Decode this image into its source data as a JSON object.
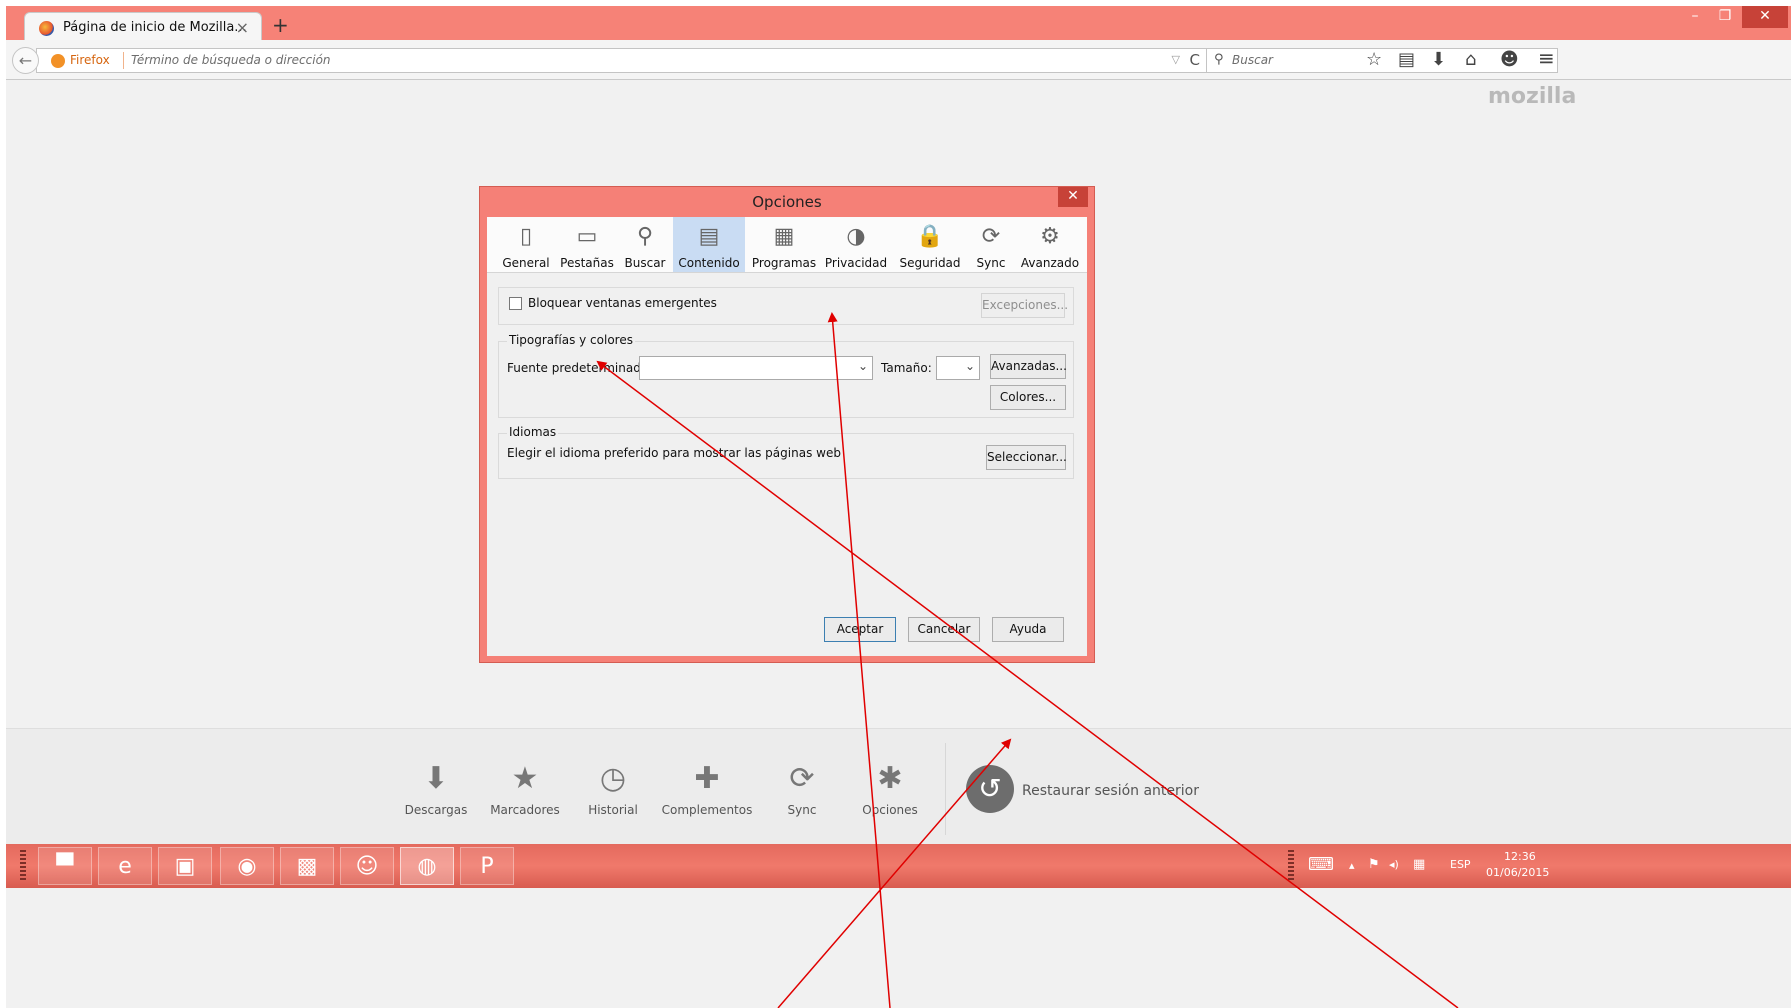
{
  "tab": {
    "title": "Página de inicio de Mozilla...",
    "close": "×",
    "new_tab": "+"
  },
  "window_controls": {
    "minimize": "–",
    "maximize": "❐",
    "close": "✕"
  },
  "navbar": {
    "back_icon": "←",
    "identity_label": "Firefox",
    "url_placeholder": "Término de búsqueda o dirección",
    "dropdown_icon": "▽",
    "reload_icon": "C",
    "search_icon": "⚲",
    "search_placeholder": "Buscar",
    "bookmark_icon": "☆",
    "reading_list_icon": "▤",
    "download_icon": "⬇",
    "home_icon": "⌂",
    "chat_icon": "☻",
    "menu_icon": "≡"
  },
  "page": {
    "logo": "mozilla",
    "launcher": [
      {
        "name": "downloads",
        "icon": "⬇",
        "label": "Descargas"
      },
      {
        "name": "bookmarks",
        "icon": "★",
        "label": "Marcadores"
      },
      {
        "name": "history",
        "icon": "◷",
        "label": "Historial"
      },
      {
        "name": "addons",
        "icon": "✚",
        "label": "Complementos"
      },
      {
        "name": "sync",
        "icon": "⟳",
        "label": "Sync"
      },
      {
        "name": "options",
        "icon": "✱",
        "label": "Opciones"
      }
    ],
    "restore_icon": "↺",
    "restore_label": "Restaurar sesión anterior"
  },
  "dialog": {
    "title": "Opciones",
    "close": "✕",
    "tabs": [
      {
        "name": "general",
        "icon": "▯",
        "label": "General"
      },
      {
        "name": "tabs",
        "icon": "▭",
        "label": "Pestañas"
      },
      {
        "name": "search",
        "icon": "⚲",
        "label": "Buscar"
      },
      {
        "name": "content",
        "icon": "▤",
        "label": "Contenido"
      },
      {
        "name": "applications",
        "icon": "▦",
        "label": "Programas"
      },
      {
        "name": "privacy",
        "icon": "◑",
        "label": "Privacidad"
      },
      {
        "name": "security",
        "icon": "🔒",
        "label": "Seguridad"
      },
      {
        "name": "sync",
        "icon": "⟳",
        "label": "Sync"
      },
      {
        "name": "advanced",
        "icon": "⚙",
        "label": "Avanzado"
      }
    ],
    "selected_tab": "Contenido",
    "popup": {
      "label": "Bloquear ventanas emergentes",
      "checked": false,
      "exceptions": "Excepciones..."
    },
    "fonts": {
      "legend": "Tipografías y colores",
      "default_font_label": "Fuente predeterminada:",
      "default_font_value": "",
      "size_label": "Tamaño:",
      "size_value": "",
      "advanced": "Avanzadas...",
      "colors": "Colores..."
    },
    "languages": {
      "legend": "Idiomas",
      "text": "Elegir el idioma preferido para mostrar las páginas web",
      "choose": "Seleccionar..."
    },
    "buttons": {
      "ok": "Aceptar",
      "cancel": "Cancelar",
      "help": "Ayuda"
    }
  },
  "taskbar": {
    "apps": [
      {
        "name": "explorer",
        "icon": "▀"
      },
      {
        "name": "internet-explorer",
        "icon": "e"
      },
      {
        "name": "media",
        "icon": "▣"
      },
      {
        "name": "chrome",
        "icon": "◉"
      },
      {
        "name": "remote",
        "icon": "▩"
      },
      {
        "name": "people",
        "icon": "☺"
      },
      {
        "name": "firefox",
        "icon": "◍"
      },
      {
        "name": "powerpoint",
        "icon": "P"
      }
    ],
    "tray": {
      "keyboard_icon": "⌨",
      "up_icon": "▴",
      "flag_icon": "⚑",
      "volume_icon": "◂)",
      "network_icon": "▦",
      "lang": "ESP",
      "time": "12:36",
      "date": "01/06/2015"
    }
  },
  "colors": {
    "chrome_accent": "#f68277",
    "taskbar": "#e46a5e",
    "annotation": "#e00000",
    "selected_tab": "#c9dcf3"
  }
}
